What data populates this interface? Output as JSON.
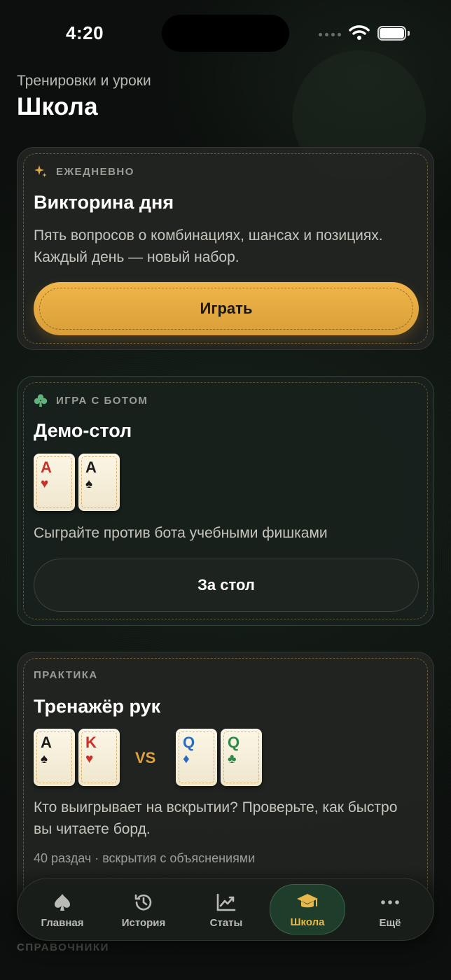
{
  "status_bar": {
    "time": "4:20"
  },
  "header": {
    "subtitle": "Тренировки и уроки",
    "title": "Школа"
  },
  "daily_card": {
    "kicker": "ЕЖЕДНЕВНО",
    "title": "Викторина дня",
    "description": "Пять вопросов о комбинациях, шансах и позициях. Каждый день — новый набор.",
    "button": "Играть"
  },
  "demo_card": {
    "kicker": "ИГРА С БОТОМ",
    "title": "Демо-стол",
    "hand": [
      {
        "rank": "A",
        "suit": "♥"
      },
      {
        "rank": "A",
        "suit": "♠"
      }
    ],
    "description": "Сыграйте против бота учебными фишками",
    "button": "За стол"
  },
  "trainer_card": {
    "kicker": "ПРАКТИКА",
    "title": "Тренажёр рук",
    "hand_a": [
      {
        "rank": "A",
        "suit": "♠"
      },
      {
        "rank": "K",
        "suit": "♥"
      }
    ],
    "vs": "VS",
    "hand_b": [
      {
        "rank": "Q",
        "suit": "♦"
      },
      {
        "rank": "Q",
        "suit": "♣"
      }
    ],
    "description": "Кто выигрывает на вскрытии? Проверьте, как быстро вы читаете борд.",
    "meta": "40 раздач · вскрытия с объяснениями"
  },
  "next_section": {
    "label": "СПРАВОЧНИКИ"
  },
  "nav": {
    "items": [
      {
        "label": "Главная",
        "icon": "spade-icon"
      },
      {
        "label": "История",
        "icon": "history-icon"
      },
      {
        "label": "Статы",
        "icon": "chart-icon"
      },
      {
        "label": "Школа",
        "icon": "graduation-cap-icon"
      },
      {
        "label": "Ещё",
        "icon": "more-icon"
      }
    ],
    "active": "Школа"
  },
  "colors": {
    "accent": "#e8b84a",
    "button_gold": "#e5aa40",
    "active_tab_bg": "#1e3d2a"
  }
}
